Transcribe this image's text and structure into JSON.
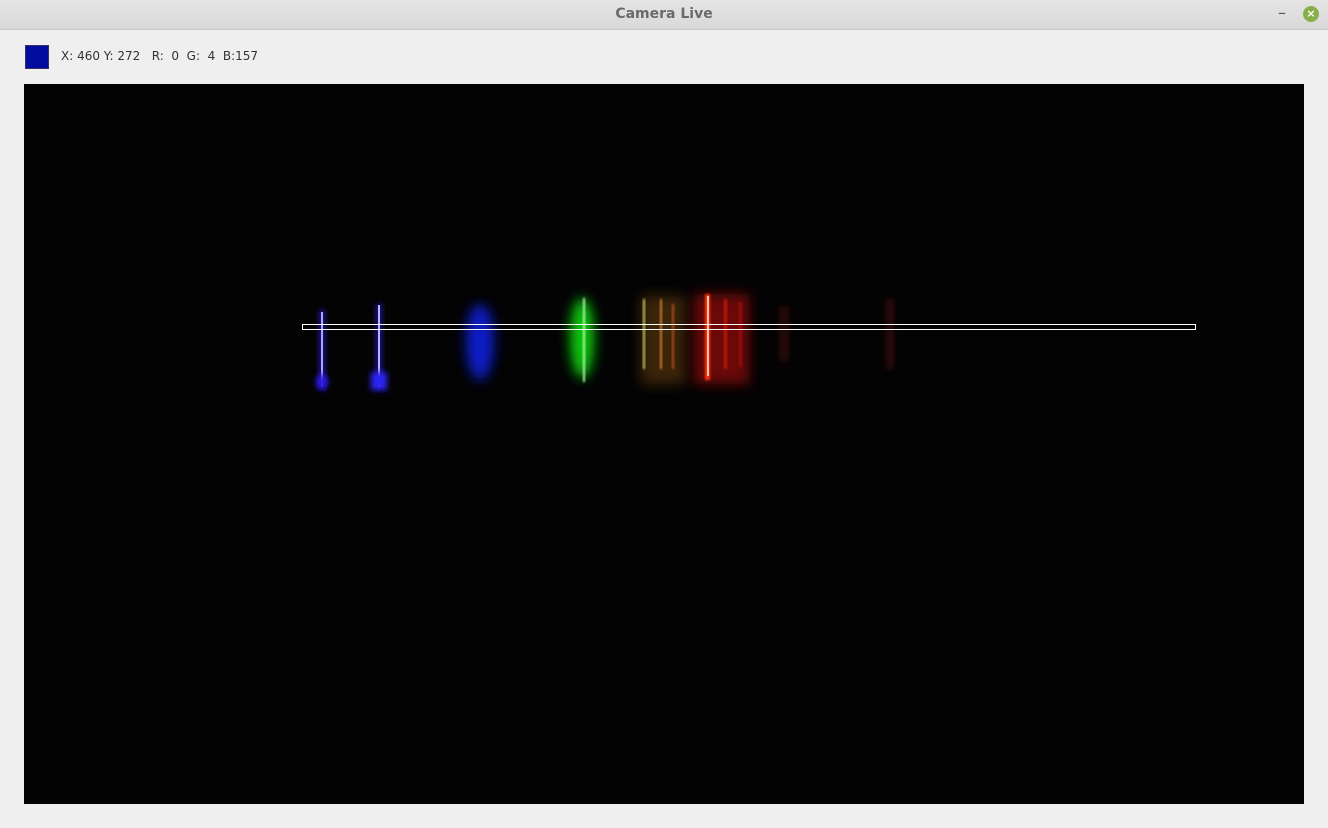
{
  "window": {
    "title": "Camera Live"
  },
  "pixel_info": {
    "swatch_color": "#000c9d",
    "readout": "X: 460 Y: 272   R:  0  G:  4  B:157"
  },
  "icons": {
    "minimize": "minimize-icon",
    "close": "close-icon"
  }
}
